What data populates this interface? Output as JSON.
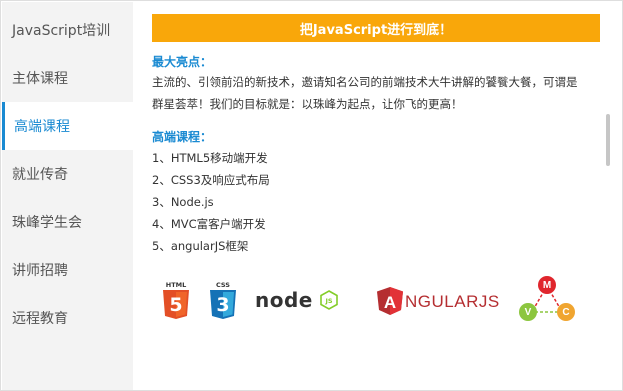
{
  "sidebar": {
    "items": [
      {
        "label": "JavaScript培训"
      },
      {
        "label": "主体课程"
      },
      {
        "label": "高端课程"
      },
      {
        "label": "就业传奇"
      },
      {
        "label": "珠峰学生会"
      },
      {
        "label": "讲师招聘"
      },
      {
        "label": "远程教育"
      }
    ],
    "active_index": 2
  },
  "main": {
    "banner": "把JavaScript进行到底！",
    "highlights_title": "最大亮点：",
    "highlights_lines": [
      "主流的、引领前沿的新技术，邀请知名公司的前端技术大牛讲解的饕餮大餐，可谓是",
      "群星荟萃！我们的目标就是：以珠峰为起点，让你飞的更高！"
    ],
    "courses_title": "高端课程：",
    "courses": [
      "1、HTML5移动端开发",
      "2、CSS3及响应式布局",
      "3、Node.js",
      "4、MVC富客户端开发",
      "5、angularJS框架"
    ],
    "logos": {
      "html5_icon": "html5-logo",
      "html5_word": "HTML",
      "html5_digit": "5",
      "css3_icon": "css3-logo",
      "css3_word": "CSS",
      "css3_digit": "3",
      "node_text": "node",
      "node_badge": "JS",
      "angular_text": "NGULARJS",
      "angular_mark": "A",
      "mvc": [
        "M",
        "V",
        "C"
      ]
    }
  },
  "colors": {
    "accent_blue": "#1a8ad2",
    "banner_orange": "#f9a70a",
    "sidebar_bg": "#f3f3f3",
    "html5_orange": "#e34f26",
    "css3_blue": "#1572b6",
    "node_green": "#83cd29",
    "angular_red": "#b52e31",
    "mvc_red": "#e0262d",
    "mvc_green": "#8cc63f",
    "mvc_orange": "#f0a530"
  }
}
